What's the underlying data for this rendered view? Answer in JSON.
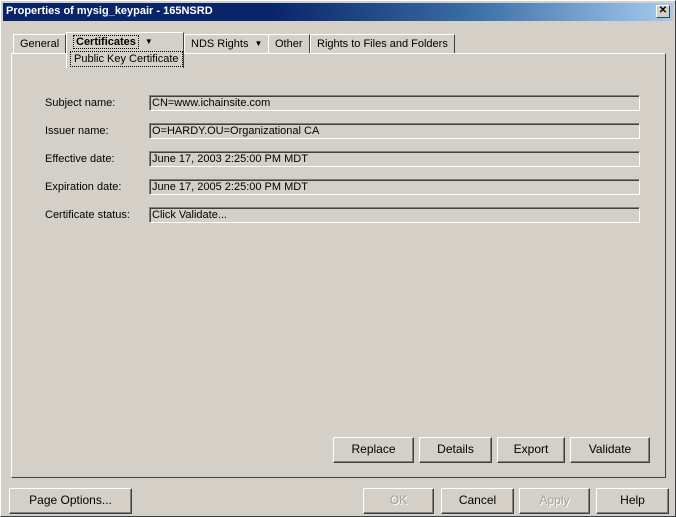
{
  "window": {
    "title": "Properties of mysig_keypair - 165NSRD",
    "close_glyph": "✕"
  },
  "tabs": [
    {
      "label": "General"
    },
    {
      "label": "Certificates",
      "sublabel": "Public Key Certificate",
      "arrow": "▼"
    },
    {
      "label": "NDS Rights",
      "arrow": "▼"
    },
    {
      "label": "Other"
    },
    {
      "label": "Rights to Files and Folders"
    }
  ],
  "fields": [
    {
      "label": "Subject name:",
      "value": "CN=www.ichainsite.com"
    },
    {
      "label": "Issuer name:",
      "value": "O=HARDY.OU=Organizational CA"
    },
    {
      "label": "Effective date:",
      "value": "June 17, 2003 2:25:00 PM MDT"
    },
    {
      "label": "Expiration date:",
      "value": "June 17, 2005 2:25:00 PM MDT"
    },
    {
      "label": "Certificate status:",
      "value": "Click Validate..."
    }
  ],
  "cert_buttons": {
    "replace": "Replace",
    "details": "Details",
    "export": "Export",
    "validate": "Validate"
  },
  "footer": {
    "page_options": "Page Options...",
    "ok": "OK",
    "cancel": "Cancel",
    "apply": "Apply",
    "help": "Help"
  },
  "colors": {
    "titlebar": "#0a246a",
    "face": "#d4d0c8"
  }
}
